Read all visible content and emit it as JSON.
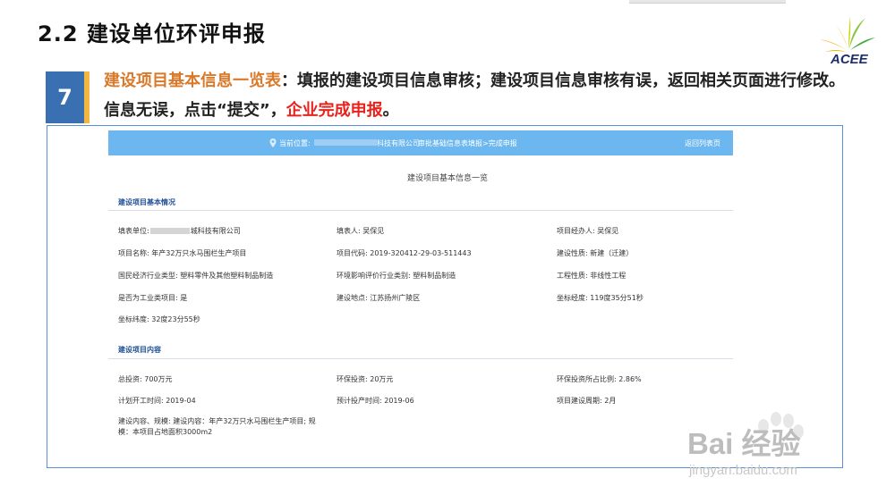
{
  "slide": {
    "title": "2.2  建设单位环评申报",
    "logo_text": "ACEE",
    "step_number": "7",
    "description": {
      "highlight": "建设项目基本信息一览表",
      "part1": "：填报的建设项目信息审核；建设项目信息审核有误，返回相关页面进行修改。信息无误，点击“提交”，",
      "red": "企业完成申报",
      "end": "。"
    }
  },
  "navbar": {
    "location_label": "当前位置:",
    "company_suffix": "科技有限公司",
    "path": "审批基础信息表填报>完成申报",
    "back_link": "返回列表页"
  },
  "page_heading": "建设项目基本信息一览",
  "basic_section": {
    "title": "建设项目基本情况",
    "fields": {
      "filler_prefix": "填表单位:",
      "filler_suffix": "城科技有限公司",
      "filler_person": "填表人: 吴保见",
      "manager": "项目经办人: 吴保见",
      "project_name": "项目名称: 年产32万只水马围栏生产项目",
      "project_code": "项目代码: 2019-320412-29-03-511443",
      "nature": "建设性质: 新建（迁建）",
      "industry": "国民经济行业类型: 塑料零件及其他塑料制品制造",
      "eia_industry": "环境影响评价行业类别: 塑料制品制造",
      "engineering": "工程性质: 非线性工程",
      "industrial": "是否为工业类项目: 是",
      "location": "建设地点:  江苏扬州广陵区",
      "longitude": "坐标经度:  119度35分51秒",
      "latitude": "坐标纬度:  32度23分55秒"
    }
  },
  "content_section": {
    "title": "建设项目内容",
    "fields": {
      "total_investment": "总投资: 700万元",
      "env_investment": "环保投资: 20万元",
      "env_ratio": "环保投资所占比例: 2.86%",
      "start_time": "计划开工时间: 2019-04",
      "production_time": "预计投产时间: 2019-06",
      "period": "项目建设周期: 2月",
      "content": "建设内容、规模: 建设内容：年产32万只水马围栏生产项目; 规模：本项目占地面积3000m2"
    }
  },
  "watermark": {
    "text": "Bai 经验",
    "url": "jingyan.baidu.com"
  },
  "colors": {
    "step_blue": "#3a6fb2",
    "accent_orange": "#d9792a",
    "accent_red": "#e8231d",
    "nav_blue": "#6cb7ef",
    "section_blue": "#1f4f95"
  }
}
